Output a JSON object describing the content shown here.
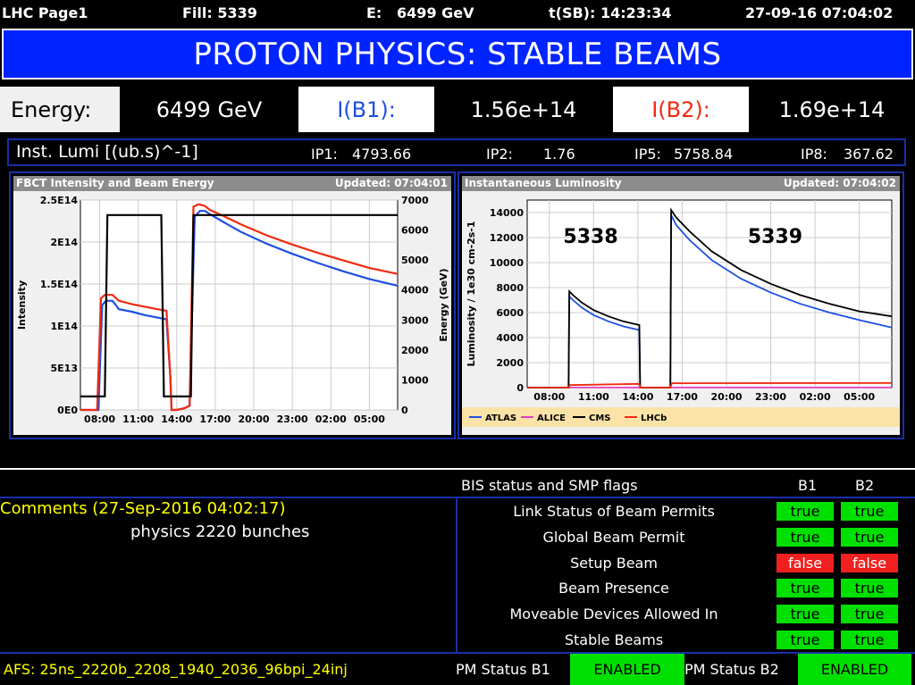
{
  "topbar": {
    "page": "LHC Page1",
    "fill": "Fill: 5339",
    "energy": "E:   6499 GeV",
    "tsb": "t(SB): 14:23:34",
    "datetime": "27-09-16 07:04:02"
  },
  "banner": {
    "title": "PROTON PHYSICS: STABLE BEAMS"
  },
  "energyrow": {
    "energy_label": "Energy:",
    "energy_value": "6499 GeV",
    "ib1_label": "I(B1):",
    "ib1_value": "1.56e+14",
    "ib2_label": "I(B2):",
    "ib2_value": "1.69e+14"
  },
  "lumirow": {
    "label": "Inst. Lumi [(ub.s)^-1]",
    "ip1_label": "IP1:",
    "ip1_value": "4793.66",
    "ip2_label": "IP2:",
    "ip2_value": "1.76",
    "ip5_label": "IP5:",
    "ip5_value": "5758.84",
    "ip8_label": "IP8:",
    "ip8_value": "367.62"
  },
  "colors": {
    "banner_blue": "#0024ff",
    "frame_blue": "#1a2fa8",
    "true_green": "#00e000",
    "false_red": "#f02020",
    "comment_yellow": "#ffff00",
    "b1_blue": "#1f4fe0",
    "b2_red": "#f02a10"
  },
  "chart_data": [
    {
      "type": "line",
      "title": "FBCT Intensity and Beam Energy",
      "updated": "Updated: 07:04:01",
      "ylabel": "Intensity",
      "y2label": "Energy (GeV)",
      "yticks": [
        "2.5E14",
        "2E14",
        "1.5E14",
        "1E14",
        "5E13",
        "0E0"
      ],
      "y2ticks": [
        "7000",
        "6000",
        "5000",
        "4000",
        "3000",
        "2000",
        "1000",
        "0"
      ],
      "xticks": [
        "08:00",
        "11:00",
        "14:00",
        "17:00",
        "20:00",
        "23:00",
        "02:00",
        "05:00"
      ],
      "xlim": [
        6.5,
        31.2
      ],
      "ylim": [
        0,
        250000000000000.0
      ],
      "y2lim": [
        0,
        7000
      ],
      "series": [
        {
          "name": "B1",
          "color": "#1f4fe0",
          "axis": "left",
          "x": [
            6.5,
            7.5,
            7.9,
            8.2,
            8.5,
            9.0,
            9.5,
            10.5,
            11.5,
            12.5,
            13.2,
            13.5,
            13.6,
            14.0,
            14.6,
            15.0,
            15.4,
            15.8,
            16.2,
            16.6,
            17.5,
            19.0,
            21.0,
            23.0,
            25.0,
            27.0,
            29.0,
            31.2
          ],
          "y": [
            0,
            0,
            0,
            125000000000000.0,
            130000000000000.0,
            130000000000000.0,
            120000000000000.0,
            117000000000000.0,
            113000000000000.0,
            110000000000000.0,
            108000000000000.0,
            40000000000000.0,
            0,
            0,
            2000000000000.0,
            5000000000000.0,
            230000000000000.0,
            237000000000000.0,
            237000000000000.0,
            233000000000000.0,
            225000000000000.0,
            212000000000000.0,
            198000000000000.0,
            186000000000000.0,
            175000000000000.0,
            165000000000000.0,
            156000000000000.0,
            148000000000000.0
          ]
        },
        {
          "name": "B2",
          "color": "#f02a10",
          "axis": "left",
          "x": [
            6.5,
            7.5,
            7.8,
            8.1,
            8.4,
            9.0,
            9.5,
            10.5,
            11.5,
            12.5,
            13.2,
            13.5,
            13.6,
            14.0,
            14.6,
            15.0,
            15.3,
            15.7,
            16.2,
            16.6,
            17.5,
            19.0,
            21.0,
            23.0,
            25.0,
            27.0,
            29.0,
            31.2
          ],
          "y": [
            0,
            0,
            0,
            133000000000000.0,
            137000000000000.0,
            137000000000000.0,
            130000000000000.0,
            126000000000000.0,
            123000000000000.0,
            120000000000000.0,
            118000000000000.0,
            40000000000000.0,
            0,
            0,
            2000000000000.0,
            5000000000000.0,
            242000000000000.0,
            245000000000000.0,
            243000000000000.0,
            238000000000000.0,
            232000000000000.0,
            221000000000000.0,
            208000000000000.0,
            197000000000000.0,
            187000000000000.0,
            178000000000000.0,
            169000000000000.0,
            162000000000000.0
          ]
        },
        {
          "name": "Energy",
          "color": "#000000",
          "axis": "right",
          "x": [
            6.5,
            7.4,
            7.6,
            8.4,
            8.6,
            12.8,
            13.0,
            13.7,
            13.9,
            14.3,
            14.5,
            15.1,
            15.3,
            31.2
          ],
          "y": [
            450,
            450,
            450,
            450,
            6500,
            6500,
            450,
            450,
            450,
            450,
            450,
            450,
            6500,
            6500
          ]
        }
      ]
    },
    {
      "type": "line",
      "title": "Instantaneous Luminosity",
      "updated": "Updated: 07:04:02",
      "ylabel": "Luminosity / 1e30 cm-2s-1",
      "yticks": [
        "14000",
        "12000",
        "10000",
        "8000",
        "6000",
        "4000",
        "2000",
        "0"
      ],
      "xticks": [
        "08:00",
        "11:00",
        "14:00",
        "17:00",
        "20:00",
        "23:00",
        "02:00",
        "05:00"
      ],
      "xlim": [
        6.5,
        31.2
      ],
      "ylim": [
        0,
        15000
      ],
      "annotations": [
        "5338",
        "5339"
      ],
      "legend": [
        "ATLAS",
        "ALICE",
        "CMS",
        "LHCb"
      ],
      "series": [
        {
          "name": "ATLAS",
          "color": "#1f4fe0",
          "x": [
            6.5,
            9.3,
            9.35,
            9.6,
            10.2,
            11.0,
            12.0,
            13.0,
            14.1,
            14.15,
            16.2,
            16.25,
            16.6,
            17.5,
            19.0,
            21.0,
            23.0,
            25.0,
            27.0,
            29.0,
            31.2
          ],
          "y": [
            0,
            0,
            7300,
            7000,
            6400,
            5800,
            5300,
            4900,
            4600,
            0,
            0,
            13800,
            13000,
            11800,
            10200,
            8700,
            7600,
            6700,
            6000,
            5400,
            4800
          ]
        },
        {
          "name": "ALICE",
          "color": "#e040c0",
          "x": [
            6.5,
            31.2
          ],
          "y": [
            10,
            10
          ]
        },
        {
          "name": "CMS",
          "color": "#000000",
          "x": [
            6.5,
            9.3,
            9.35,
            9.6,
            10.2,
            11.0,
            12.0,
            13.0,
            14.1,
            14.15,
            16.2,
            16.25,
            16.6,
            17.5,
            19.0,
            21.0,
            23.0,
            25.0,
            27.0,
            29.0,
            31.2
          ],
          "y": [
            0,
            0,
            7700,
            7400,
            6800,
            6200,
            5700,
            5300,
            5000,
            0,
            0,
            14200,
            13600,
            12500,
            10900,
            9400,
            8300,
            7400,
            6700,
            6100,
            5700
          ]
        },
        {
          "name": "LHCb",
          "color": "#f02a10",
          "x": [
            6.5,
            9.3,
            9.4,
            14.1,
            14.15,
            16.2,
            16.3,
            31.2
          ],
          "y": [
            0,
            0,
            200,
            300,
            0,
            0,
            350,
            370
          ]
        }
      ]
    }
  ],
  "bis": {
    "header": "BIS status and SMP flags",
    "b1_header": "B1",
    "b2_header": "B2",
    "rows": [
      {
        "label": "Link Status of Beam Permits",
        "b1": "true",
        "b2": "true"
      },
      {
        "label": "Global Beam Permit",
        "b1": "true",
        "b2": "true"
      },
      {
        "label": "Setup Beam",
        "b1": "false",
        "b2": "false"
      },
      {
        "label": "Beam Presence",
        "b1": "true",
        "b2": "true"
      },
      {
        "label": "Moveable Devices Allowed In",
        "b1": "true",
        "b2": "true"
      },
      {
        "label": "Stable Beams",
        "b1": "true",
        "b2": "true"
      }
    ]
  },
  "comments": {
    "header": "Comments (27-Sep-2016 04:02:17)",
    "text": "physics 2220 bunches"
  },
  "footer": {
    "afs": "AFS: 25ns_2220b_2208_1940_2036_96bpi_24inj",
    "pm_b1_label": "PM Status B1",
    "pm_b1_value": "ENABLED",
    "pm_b2_label": "PM Status B2",
    "pm_b2_value": "ENABLED"
  }
}
